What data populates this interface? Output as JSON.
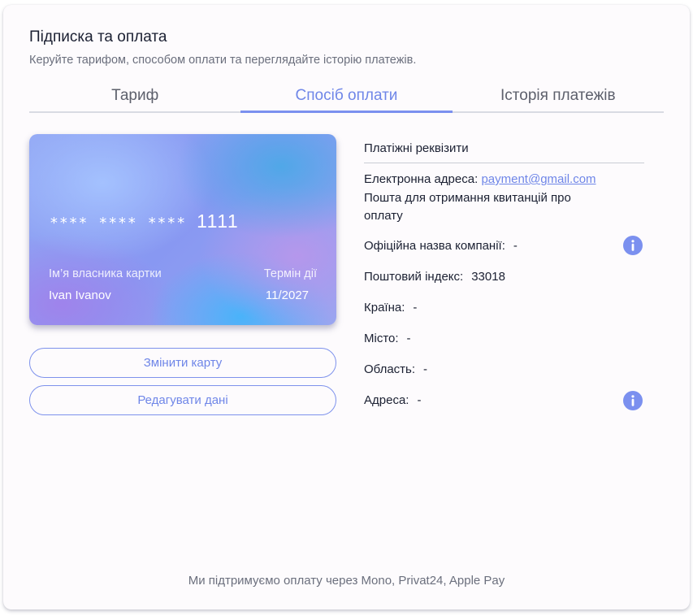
{
  "header": {
    "title": "Підписка та оплата",
    "subtitle": "Керуйте тарифом, способом оплати та переглядайте історію платежів."
  },
  "tabs": [
    {
      "label": "Тариф",
      "active": false
    },
    {
      "label": "Спосіб оплати",
      "active": true
    },
    {
      "label": "Історія платежів",
      "active": false
    }
  ],
  "card": {
    "mask_groups": [
      "****",
      "****",
      "****"
    ],
    "last_digits": "1111",
    "holder_label": "Ім’я власника картки",
    "holder_name": "Ivan Ivanov",
    "expiry_label": "Термін дії",
    "expiry_value": "11/2027"
  },
  "buttons": {
    "change_card": "Змінити карту",
    "edit_data": "Редагувати дані"
  },
  "details": {
    "heading": "Платіжні реквізити",
    "email_label": "Електронна адреса:",
    "email_value": "payment@gmail.com",
    "email_note": "Пошта для отримання квитанцій про оплату",
    "company_label": "Офіційна назва компанії:",
    "company_value": "-",
    "postal_label": "Поштовий індекс:",
    "postal_value": "33018",
    "country_label": "Країна:",
    "country_value": "-",
    "city_label": "Місто:",
    "city_value": "-",
    "region_label": "Область:",
    "region_value": "-",
    "address_label": "Адреса:",
    "address_value": "-"
  },
  "icons": {
    "info": "info-icon"
  },
  "colors": {
    "accent": "#7b90ef",
    "text": "#1b2032",
    "muted": "#6b6f7d"
  },
  "footer": {
    "text": "Ми підтримуємо оплату через Mono, Privat24, Apple Pay"
  }
}
